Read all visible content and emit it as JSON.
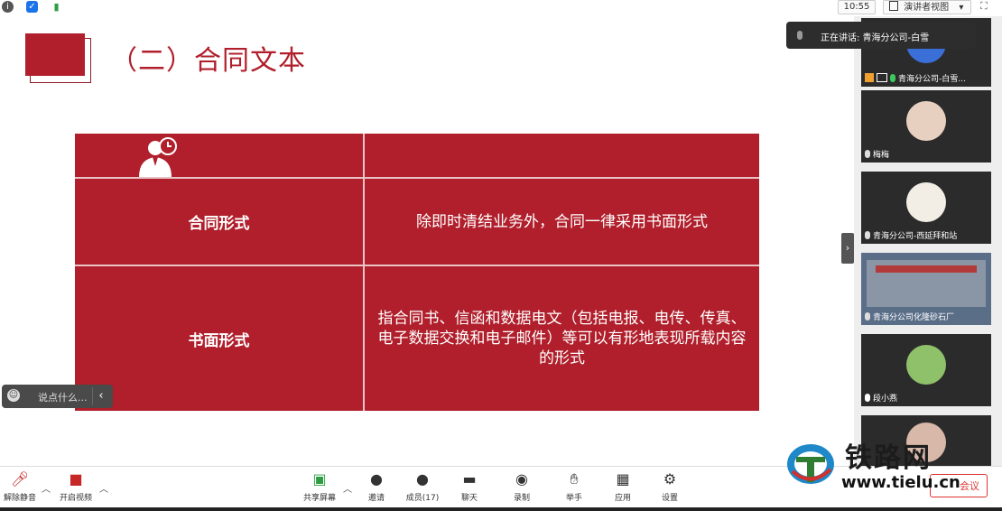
{
  "topbar": {
    "clock": "10:55",
    "view_label": "演讲者视图",
    "view_caret": "▾"
  },
  "slide": {
    "title": "（二）合同文本",
    "rows": [
      {
        "left": "合同形式",
        "right": "除即时清结业务外，合同一律采用书面形式"
      },
      {
        "left": "书面形式",
        "right": "指合同书、信函和数据电文（包括电报、电传、传真、电子数据交换和电子邮件）等可以有形地表现所载内容的形式"
      }
    ],
    "accent_color": "#b01f2b"
  },
  "chat": {
    "placeholder": "说点什么..."
  },
  "speaking": {
    "text": "正在讲话: 青海分公司-白雪"
  },
  "participants": [
    {
      "name": "青海分公司-白雪..."
    },
    {
      "name": "梅梅"
    },
    {
      "name": "青海分公司-西延拜和站"
    },
    {
      "name": "青海分公司化隆砂石厂"
    },
    {
      "name": "段小燕"
    }
  ],
  "toolbar": {
    "unmute": "解除静音",
    "start_video": "开启视频",
    "share": "共享屏幕",
    "invite": "邀请",
    "members": "成员(17)",
    "chat": "聊天",
    "record": "录制",
    "raise_hand": "举手",
    "apps": "应用",
    "settings": "设置",
    "end": "会议"
  },
  "watermark": {
    "brand": "铁路网",
    "url": "www.tielu.cn"
  }
}
